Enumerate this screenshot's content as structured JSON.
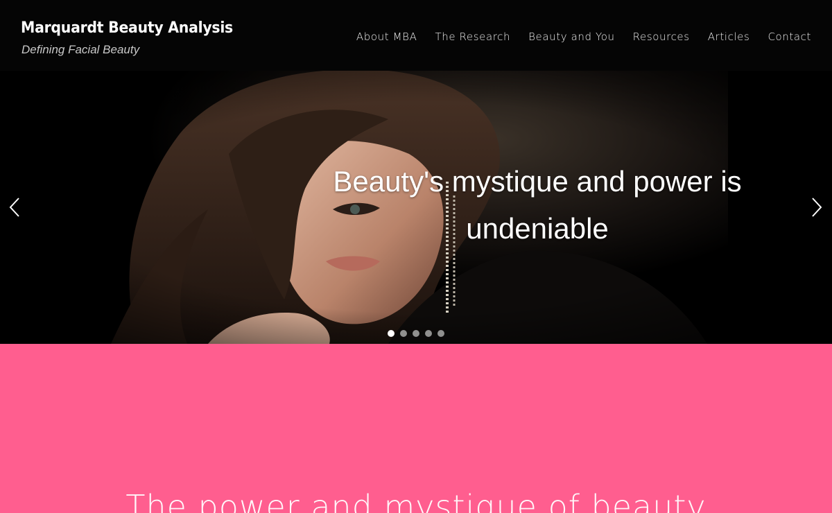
{
  "header": {
    "title": "Marquardt Beauty Analysis",
    "tagline": "Defining Facial Beauty"
  },
  "nav": {
    "items": [
      "About MBA",
      "The Research",
      "Beauty and You",
      "Resources",
      "Articles",
      "Contact"
    ]
  },
  "hero": {
    "caption_line1": "Beauty's mystique and power is",
    "caption_line2": "undeniable",
    "slide_count": 5,
    "active_slide": 1,
    "prev_icon": "chevron-left-icon",
    "next_icon": "chevron-right-icon"
  },
  "section": {
    "heading": "The power and mystique of beauty"
  },
  "colors": {
    "header_bg": "#050505",
    "accent_pink": "#ff5e8f",
    "text_white": "#ffffff"
  }
}
